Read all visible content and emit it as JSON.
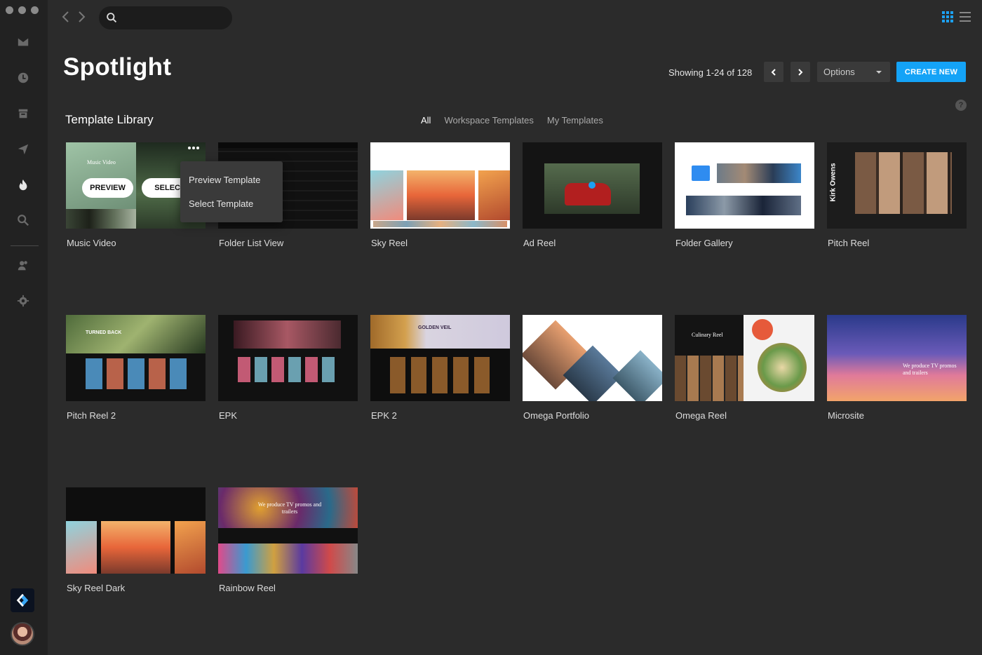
{
  "header": {
    "title": "Spotlight",
    "showing": "Showing 1-24 of 128",
    "options_label": "Options",
    "create_label": "CREATE NEW"
  },
  "search": {
    "placeholder": ""
  },
  "library": {
    "title": "Template Library",
    "filters": [
      "All",
      "Workspace Templates",
      "My Templates"
    ],
    "active_filter": "All",
    "help": "?"
  },
  "hover_card": {
    "preview_label": "PREVIEW",
    "select_label": "SELECT"
  },
  "context_menu": {
    "items": [
      "Preview Template",
      "Select Template"
    ]
  },
  "templates": [
    {
      "label": "Music Video"
    },
    {
      "label": "Folder List View"
    },
    {
      "label": "Sky Reel"
    },
    {
      "label": "Ad Reel"
    },
    {
      "label": "Folder Gallery"
    },
    {
      "label": "Pitch Reel"
    },
    {
      "label": "Pitch Reel 2"
    },
    {
      "label": "EPK"
    },
    {
      "label": "EPK 2"
    },
    {
      "label": "Omega Portfolio"
    },
    {
      "label": "Omega Reel"
    },
    {
      "label": "Microsite"
    },
    {
      "label": "Sky Reel Dark"
    },
    {
      "label": "Rainbow Reel"
    }
  ],
  "thumb_text": {
    "music_video": "Music Video",
    "pitch_reel_name": "Kirk Owens",
    "pitch_reel2": "TURNED BACK",
    "golden_veil": "GOLDEN VEIL",
    "culinary": "Culinary Reel",
    "microsite": "We produce TV promos and trailers",
    "rainbow": "We produce TV promos and trailers"
  },
  "colors": {
    "accent": "#14a3f7",
    "background": "#2b2b2b",
    "sidebar": "#222222"
  }
}
